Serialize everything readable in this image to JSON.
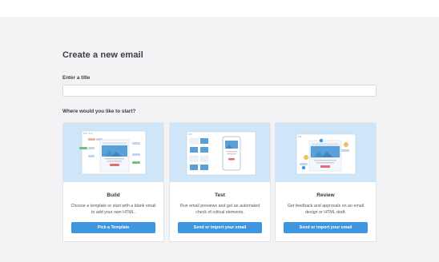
{
  "page": {
    "title": "Create a new email",
    "title_field_label": "Enter a title",
    "title_field_value": "",
    "start_question": "Where would you like to start?"
  },
  "cards": [
    {
      "title": "Build",
      "description": "Choose a template or start with a blank email to add your own HTML.",
      "button_label": "Pick a Template"
    },
    {
      "title": "Test",
      "description": "Run email previews and get an automated check of critical elements.",
      "button_label": "Send or import your email"
    },
    {
      "title": "Review",
      "description": "Get feedback and approvals on an email design or HTML draft.",
      "button_label": "Send or import your email"
    }
  ],
  "colors": {
    "accent": "#3f95de",
    "card_art_background": "#cfe6f8",
    "page_background": "#f3f3f5"
  }
}
